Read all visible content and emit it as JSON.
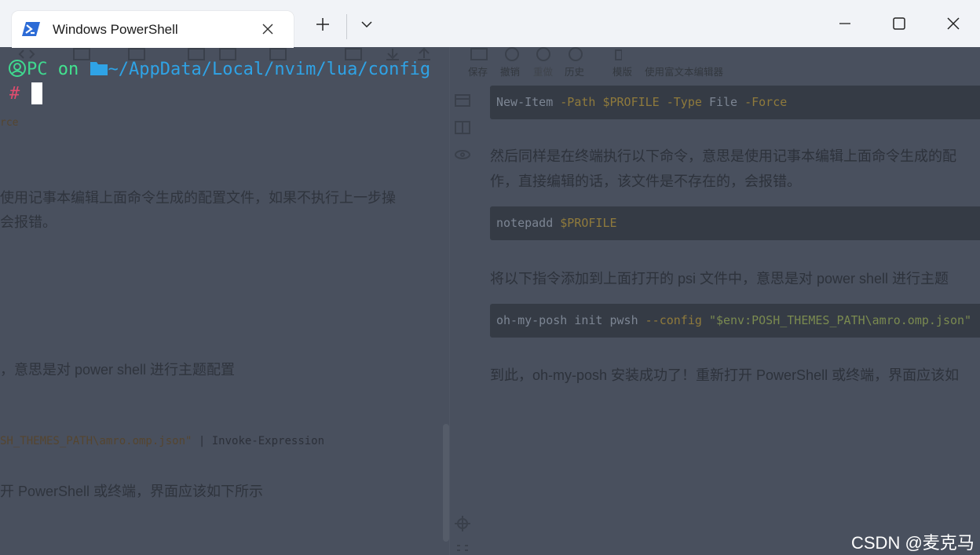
{
  "window": {
    "tab_title": "Windows PowerShell",
    "new_tab_label": "+",
    "buttons": {
      "minimize": "minimize-icon",
      "maximize": "maximize-icon",
      "close": "close-icon"
    }
  },
  "terminal": {
    "prompt_user": "PC",
    "prompt_on": "on",
    "prompt_path": "~/AppData/Local/nvim/lua/config",
    "prompt_symbol": "#"
  },
  "background": {
    "toolbar_labels": [
      "保存",
      "撤销",
      "重做",
      "历史",
      "模版",
      "使用富文本编辑器"
    ],
    "left": {
      "fragment_force": "rce",
      "para1_line1": "使用记事本编辑上面命令生成的配置文件，如果不执行上一步操",
      "para1_line2": "会报错。",
      "para2": "，意思是对 power shell 进行主题配置",
      "code_part1": "SH_THEMES_PATH\\amro.omp.json\"",
      "code_pipe": "|",
      "code_part2": "Invoke-Expression",
      "para3": "开 PowerShell 或终端，界面应该如下所示"
    },
    "right": {
      "code1_cmd": "New-Item",
      "code1_flag1": "-Path",
      "code1_var": "$PROFILE",
      "code1_flag2": "-Type",
      "code1_arg": "File",
      "code1_flag3": "-Force",
      "para1_line1": "然后同样是在终端执行以下命令，意思是使用记事本编辑上面命令生成的配",
      "para1_line2": "作，直接编辑的话，该文件是不存在的，会报错。",
      "code2_cmd": "notepadd",
      "code2_var": "$PROFILE",
      "para2": "将以下指令添加到上面打开的 psi 文件中，意思是对 power shell 进行主题",
      "code3_cmd": "oh-my-posh init pwsh",
      "code3_flag": "--config",
      "code3_str": "\"$env:POSH_THEMES_PATH\\amro.omp.json\"",
      "para3": "到此，oh-my-posh 安装成功了！重新打开 PowerShell 或终端，界面应该如"
    }
  },
  "watermark": "CSDN @麦克马"
}
